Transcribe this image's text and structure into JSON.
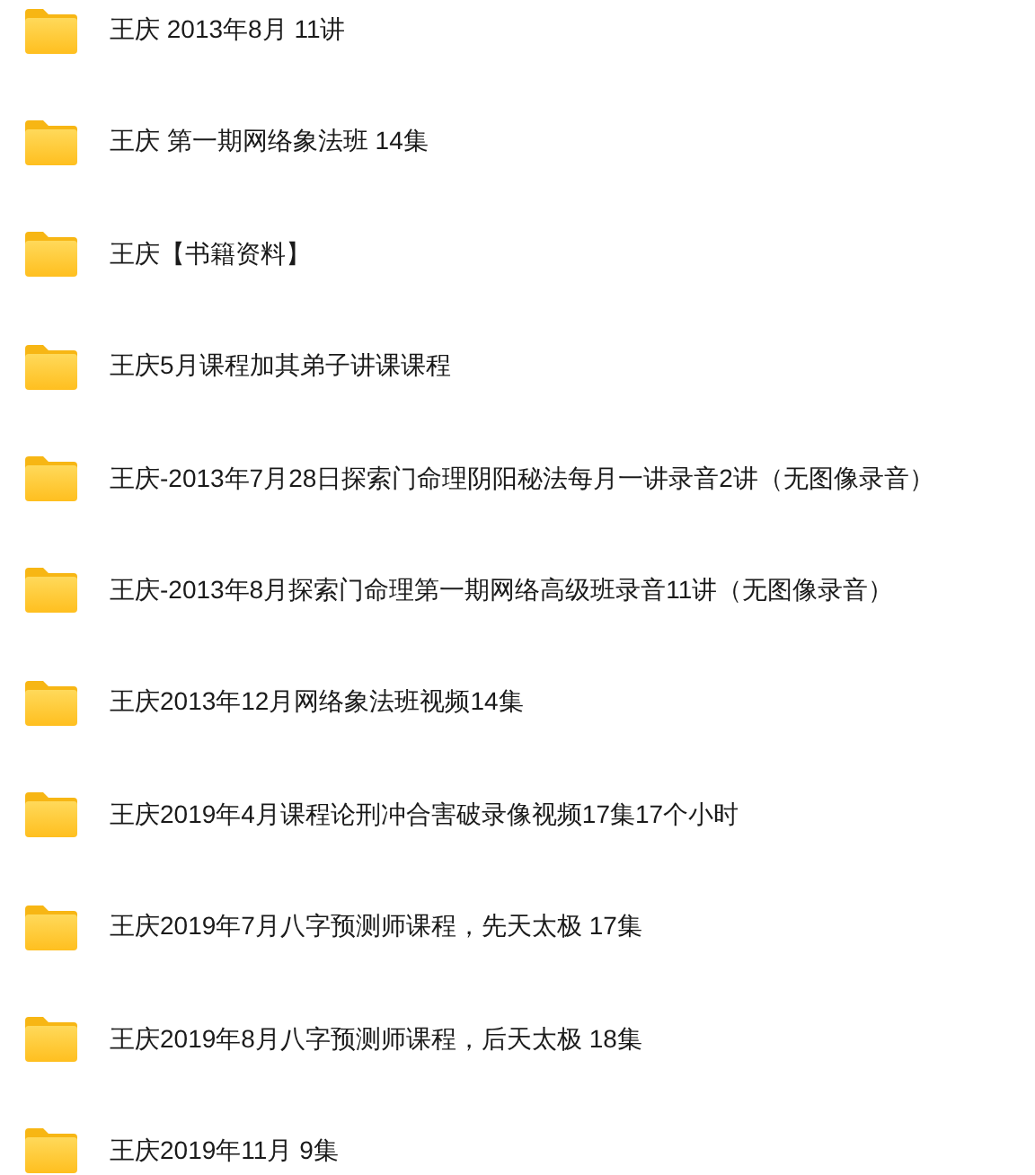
{
  "folders": [
    {
      "name": "王庆 2013年8月 11讲"
    },
    {
      "name": "王庆 第一期网络象法班 14集"
    },
    {
      "name": "王庆【书籍资料】"
    },
    {
      "name": "王庆5月课程加其弟子讲课课程"
    },
    {
      "name": "王庆-2013年7月28日探索门命理阴阳秘法每月一讲录音2讲（无图像录音）"
    },
    {
      "name": "王庆-2013年8月探索门命理第一期网络高级班录音11讲（无图像录音）"
    },
    {
      "name": "王庆2013年12月网络象法班视频14集"
    },
    {
      "name": "王庆2019年4月课程论刑冲合害破录像视频17集17个小时"
    },
    {
      "name": "王庆2019年7月八字预测师课程，先天太极 17集"
    },
    {
      "name": "王庆2019年8月八字预测师课程，后天太极 18集"
    },
    {
      "name": "王庆2019年11月 9集"
    }
  ]
}
